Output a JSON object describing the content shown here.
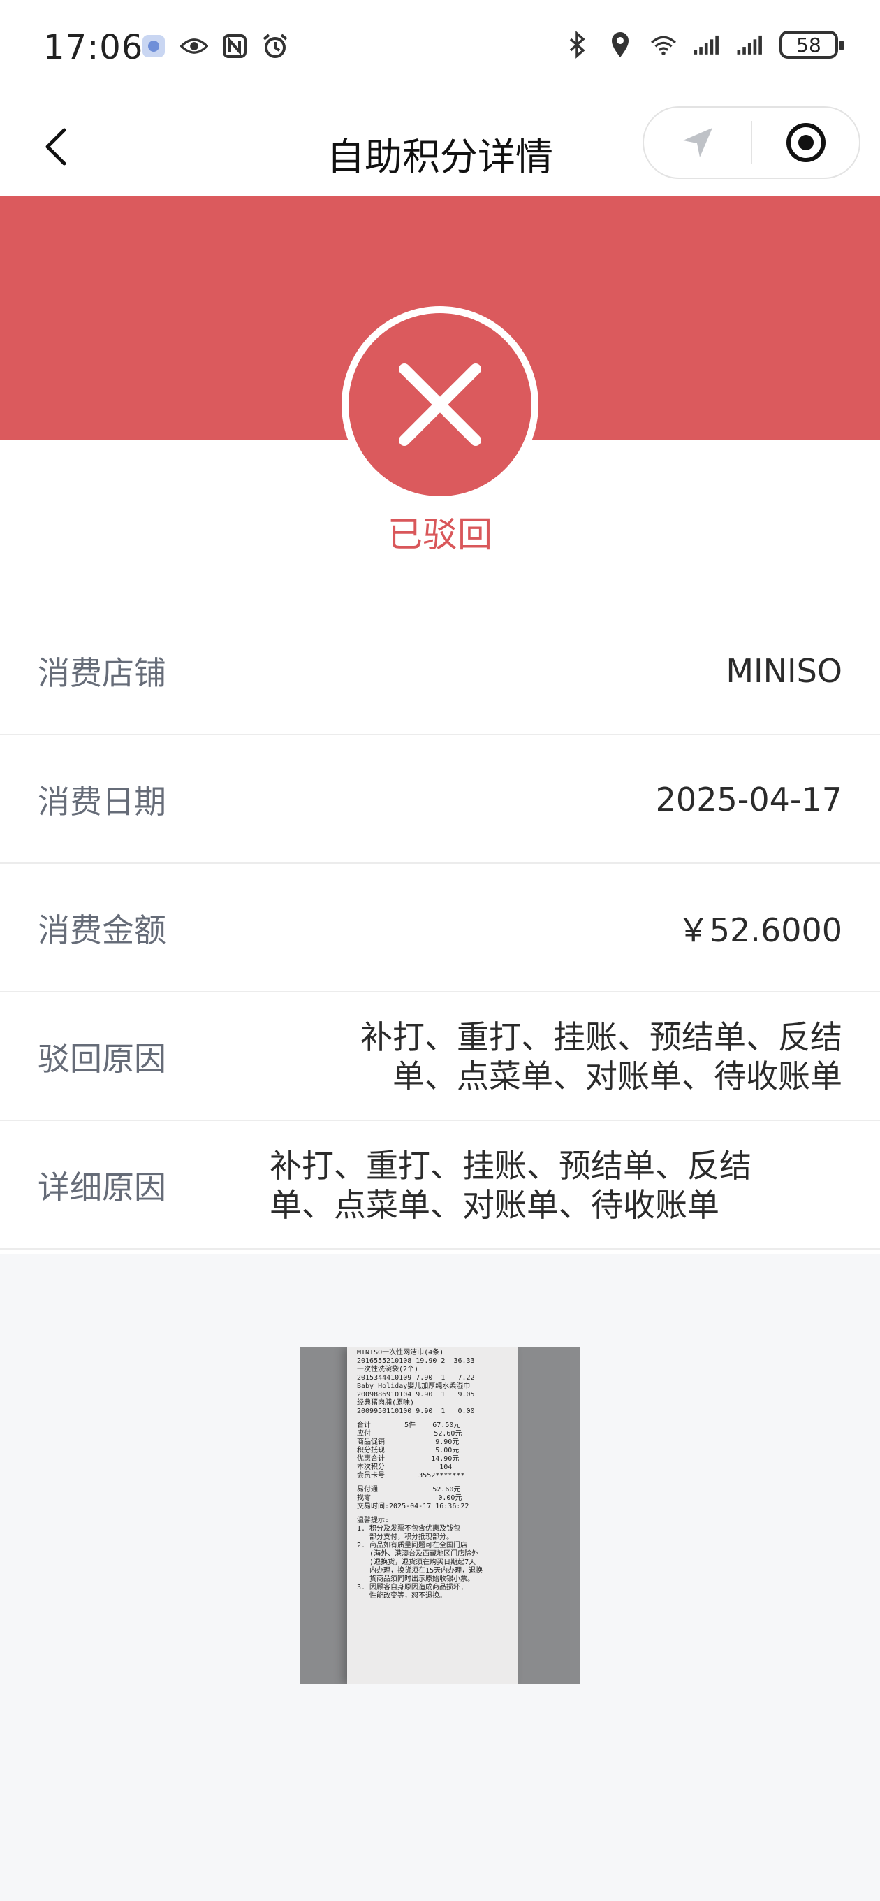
{
  "status_bar": {
    "time": "17:06",
    "battery": "58",
    "left_icons": [
      "app-badge-icon",
      "eye-icon",
      "nfc-icon",
      "alarm-icon"
    ],
    "right_icons": [
      "bluetooth-icon",
      "location-icon",
      "wifi-icon",
      "signal-icon",
      "signal-icon"
    ]
  },
  "nav": {
    "title": "自助积分详情",
    "back_icon": "chevron-left-icon",
    "capsule_icons": [
      "navigate-icon",
      "record-icon"
    ]
  },
  "status": {
    "icon": "close-icon",
    "text": "已驳回",
    "color": "#db5a5d"
  },
  "details": [
    {
      "label": "消费店铺",
      "value": "MINISO"
    },
    {
      "label": "消费日期",
      "value": "2025-04-17"
    },
    {
      "label": "消费金额",
      "value": "￥52.6000"
    },
    {
      "label": "驳回原因",
      "value": "补打、重打、挂账、预结单、反结单、点菜单、对账单、待收账单"
    },
    {
      "label": "详细原因",
      "value": "补打、重打、挂账、预结单、反结单、点菜单、对账单、待收账单"
    }
  ],
  "receipt": {
    "lines": [
      "MINISO一次性网洁巾(4条)",
      "2016555210108 19.90 2  36.33",
      "一次性洗碗袋(2个)",
      "2015344410109 7.90  1   7.22",
      "Baby Holiday婴儿加厚纯水柔湿巾",
      "2009886910104 9.90  1   9.05",
      "经典猪肉脯(原味)",
      "2009950110100 9.90  1   0.00",
      "合计        5件    67.50元",
      "应付               52.60元",
      "商品促销            9.90元",
      "积分抵现            5.00元",
      "优惠合计           14.90元",
      "本次积分             104",
      "会员卡号        3552*******",
      "易付通             52.60元",
      "找零                0.00元",
      "交易时间:2025-04-17 16:36:22",
      "温馨提示:",
      "1. 积分及发票不包含优惠及钱包",
      "   部分支付，积分抵现部分。",
      "2. 商品如有质量问题可在全国门店",
      "   (海外、港澳台及西藏地区门店除外",
      "   )退换货，退货须在购买日期起7天",
      "   内办理，换货须在15天内办理，退换",
      "   货商品须同时出示原始收银小票。",
      "3. 因顾客自身原因造成商品损坏,",
      "   性能改变等，恕不退换。"
    ]
  }
}
